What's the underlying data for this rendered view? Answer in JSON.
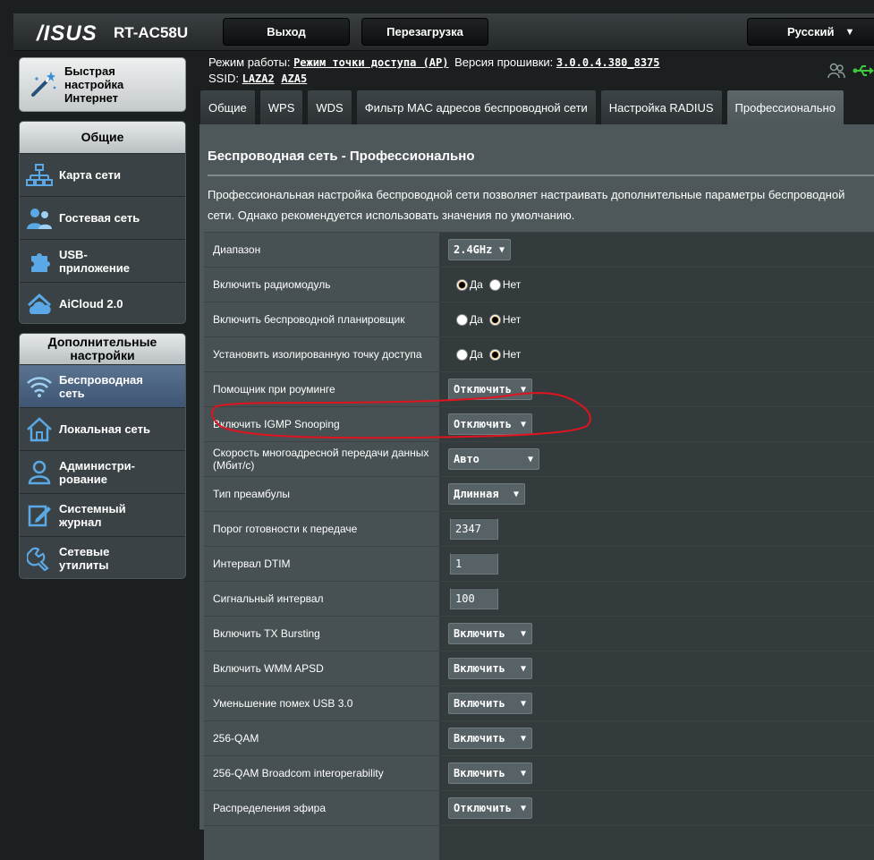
{
  "header": {
    "brand": "/ISUS",
    "model": "RT-AC58U",
    "logout_label": "Выход",
    "reboot_label": "Перезагрузка",
    "language": "Русский"
  },
  "sidebar": {
    "quick_setup": "Быстрая настройка Интернет",
    "general_title": "Общие",
    "general_items": [
      {
        "label": "Карта сети",
        "icon": "network-map-icon"
      },
      {
        "label": "Гостевая сеть",
        "icon": "guest-network-icon"
      },
      {
        "label": "USB-приложение",
        "icon": "usb-app-icon"
      },
      {
        "label": "AiCloud 2.0",
        "icon": "aicloud-icon"
      }
    ],
    "advanced_title": "Дополнительные настройки",
    "advanced_items": [
      {
        "label": "Беспроводная сеть",
        "icon": "wireless-icon",
        "active": true
      },
      {
        "label": "Локальная сеть",
        "icon": "lan-home-icon"
      },
      {
        "label": "Администри-рование",
        "icon": "admin-user-icon"
      },
      {
        "label": "Системный журнал",
        "icon": "system-log-icon"
      },
      {
        "label": "Сетевые утилиты",
        "icon": "network-tools-icon"
      }
    ]
  },
  "status": {
    "mode_label": "Режим работы:",
    "mode_value": "Режим точки доступа (AP)",
    "firmware_label": "Версия прошивки:",
    "firmware_value": "3.0.0.4.380_8375",
    "ssid_label": "SSID:",
    "ssid_1": "LAZA2",
    "ssid_2": "AZA5"
  },
  "tabs": [
    {
      "label": "Общие"
    },
    {
      "label": "WPS"
    },
    {
      "label": "WDS"
    },
    {
      "label": "Фильтр MAC адресов беспроводной сети"
    },
    {
      "label": "Настройка RADIUS"
    },
    {
      "label": "Профессионально",
      "active": true
    }
  ],
  "page": {
    "title": "Беспроводная сеть - Профессионально",
    "description": "Профессиональная настройка беспроводной сети позволяет настраивать дополнительные параметры беспроводной сети. Однако рекомендуется использовать значения по умолчанию."
  },
  "radio_yes": "Да",
  "radio_no": "Нет",
  "settings": [
    {
      "label": "Диапазон",
      "type": "select",
      "value": "2.4GHz"
    },
    {
      "label": "Включить радиомодуль",
      "type": "radio",
      "value": "yes"
    },
    {
      "label": "Включить беспроводной планировщик",
      "type": "radio",
      "value": "no"
    },
    {
      "label": "Установить изолированную точку доступа",
      "type": "radio",
      "value": "no"
    },
    {
      "label": "Помощник при роуминге",
      "type": "select",
      "value": "Отключить"
    },
    {
      "label": "Включить IGMP Snooping",
      "type": "select",
      "value": "Отключить"
    },
    {
      "label": "Скорость многоадресной передачи данных (Мбит/с)",
      "type": "select",
      "value": "Авто"
    },
    {
      "label": "Тип преамбулы",
      "type": "select",
      "value": "Длинная"
    },
    {
      "label": "Порог готовности к передаче",
      "type": "text",
      "value": "2347"
    },
    {
      "label": "Интервал DTIM",
      "type": "text",
      "value": "1"
    },
    {
      "label": "Сигнальный интервал",
      "type": "text",
      "value": "100"
    },
    {
      "label": "Включить TX Bursting",
      "type": "select",
      "value": "Включить"
    },
    {
      "label": "Включить WMM APSD",
      "type": "select",
      "value": "Включить"
    },
    {
      "label": "Уменьшение помех USB 3.0",
      "type": "select",
      "value": "Включить"
    },
    {
      "label": "256-QAM",
      "type": "select",
      "value": "Включить"
    },
    {
      "label": "256-QAM Broadcom interoperability",
      "type": "select",
      "value": "Включить"
    },
    {
      "label": "Распределения эфира",
      "type": "select",
      "value": "Отключить"
    }
  ],
  "colors": {
    "annotation": "#e0141e",
    "active_tab": "#5c6668",
    "active_menu": "#4a6482"
  }
}
